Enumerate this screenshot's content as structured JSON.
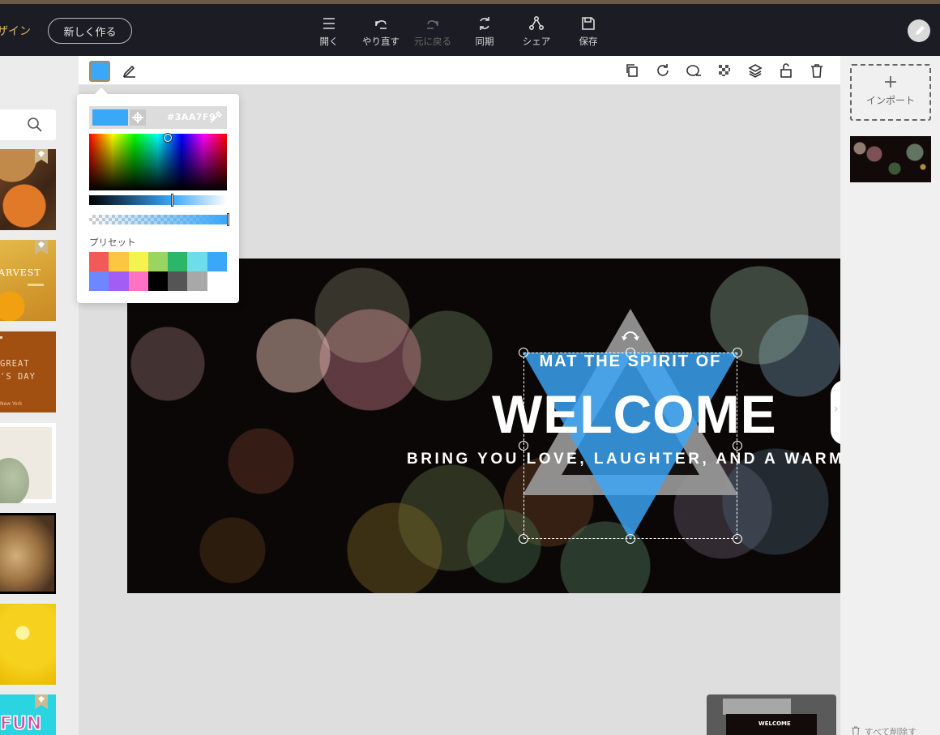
{
  "header": {
    "brand_partial": "ザイン",
    "new_button": "新しく作る",
    "tools": [
      {
        "label": "開く",
        "icon": "menu-icon",
        "enabled": true
      },
      {
        "label": "やり直す",
        "icon": "undo-icon",
        "enabled": true
      },
      {
        "label": "元に戻る",
        "icon": "redo-icon",
        "enabled": false
      },
      {
        "label": "同期",
        "icon": "sync-icon",
        "enabled": true
      },
      {
        "label": "シェア",
        "icon": "share-icon",
        "enabled": true
      },
      {
        "label": "保存",
        "icon": "save-icon",
        "enabled": true
      }
    ]
  },
  "left_sidebar": {
    "search_icon": "search-icon",
    "templates": [
      {
        "theme": "pumpkins"
      },
      {
        "theme": "harvest",
        "text": "ARVEST"
      },
      {
        "theme": "thanksgiving",
        "line1": "GREAT",
        "line2": "'S DAY",
        "line3": "New York"
      },
      {
        "theme": "leaf"
      },
      {
        "theme": "portrait"
      },
      {
        "theme": "lemon"
      },
      {
        "theme": "fun",
        "text": "FUN"
      }
    ]
  },
  "editor_toolbar": {
    "fill_color": "#3AA7F9",
    "right_icons": [
      "duplicate-icon",
      "rotate-icon",
      "shape-icon",
      "transparency-icon",
      "layers-icon",
      "lock-icon",
      "delete-icon"
    ]
  },
  "color_picker": {
    "hex": "#3AA7F9",
    "preset_label": "プリセット",
    "presets": [
      "#F25A5A",
      "#FCC645",
      "#F4F450",
      "#9AD463",
      "#2DB569",
      "#6FDCEA",
      "#3AA7F9",
      "#6E87FF",
      "#A25DF5",
      "#FF71C2",
      "#000000",
      "#555555",
      "#A8A8A8",
      "#FFFFFF"
    ]
  },
  "canvas": {
    "line1": "MAT THE SPIRIT OF",
    "line2": "WELCOME",
    "line3": "BRING YOU LOVE, LAUGHTER, AND A WARM HEAR"
  },
  "right_panel": {
    "import_plus": "+",
    "import_label": "インポート",
    "delete_all": "すべて削除す"
  },
  "minimap": {
    "text": "WELCOME"
  }
}
